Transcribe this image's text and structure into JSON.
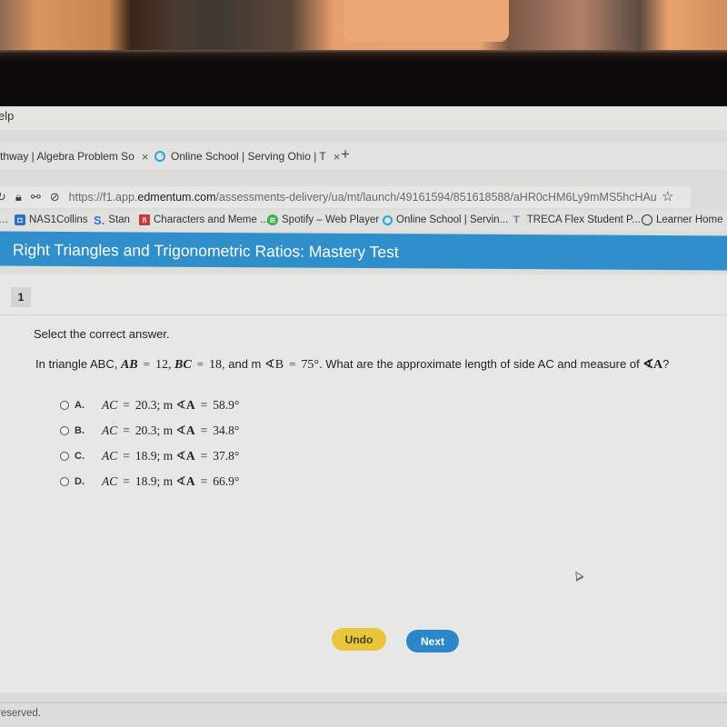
{
  "browser": {
    "menu_partial": "elp",
    "tabs": [
      {
        "label": "thway | Algebra Problem So",
        "close": "×"
      },
      {
        "label": "Online School | Serving Ohio | T",
        "close": "×"
      }
    ],
    "new_tab": "+",
    "url_prefix": "https://f1.app.",
    "url_domain": "edmentum.com",
    "url_path": "/assessments-delivery/ua/mt/launch/49161594/851618588/aHR0cHM6Ly9mMS5hcHAu",
    "star": "☆",
    "bookmarks": [
      {
        "label": "NAS1Collins",
        "icon": "nas-icon"
      },
      {
        "label": "Stan",
        "icon": "stan-icon"
      },
      {
        "label": "Characters and Meme ...",
        "icon": "characters-icon"
      },
      {
        "label": "Spotify – Web Player",
        "icon": "spotify-icon"
      },
      {
        "label": "Online School | Servin...",
        "icon": "online-school-icon"
      },
      {
        "label": "TRECA Flex Student P...",
        "icon": "treca-icon"
      },
      {
        "label": "Learner Home",
        "icon": "globe-icon"
      }
    ]
  },
  "app": {
    "title": "Right Triangles and Trigonometric Ratios: Mastery Test"
  },
  "question": {
    "number": "1",
    "instruction": "Select the correct answer.",
    "prefix": "In triangle ABC,",
    "ab_label": "AB",
    "ab_value": "12",
    "bc_label": "BC",
    "bc_value": "18",
    "and_text": ", and m",
    "angle_b": "∢B",
    "angle_b_value": "75°",
    "suffix": ". What are the approximate length of side AC and measure of",
    "angle_a": "∢A",
    "end": "?",
    "options": [
      {
        "letter": "A.",
        "ac": "20.3",
        "angle": "58.9°"
      },
      {
        "letter": "B.",
        "ac": "20.3",
        "angle": "34.8°"
      },
      {
        "letter": "C.",
        "ac": "18.9",
        "angle": "37.8°"
      },
      {
        "letter": "D.",
        "ac": "18.9",
        "angle": "66.9°"
      }
    ]
  },
  "buttons": {
    "undo": "Undo",
    "next": "Next"
  },
  "footer": {
    "text": "reserved."
  }
}
